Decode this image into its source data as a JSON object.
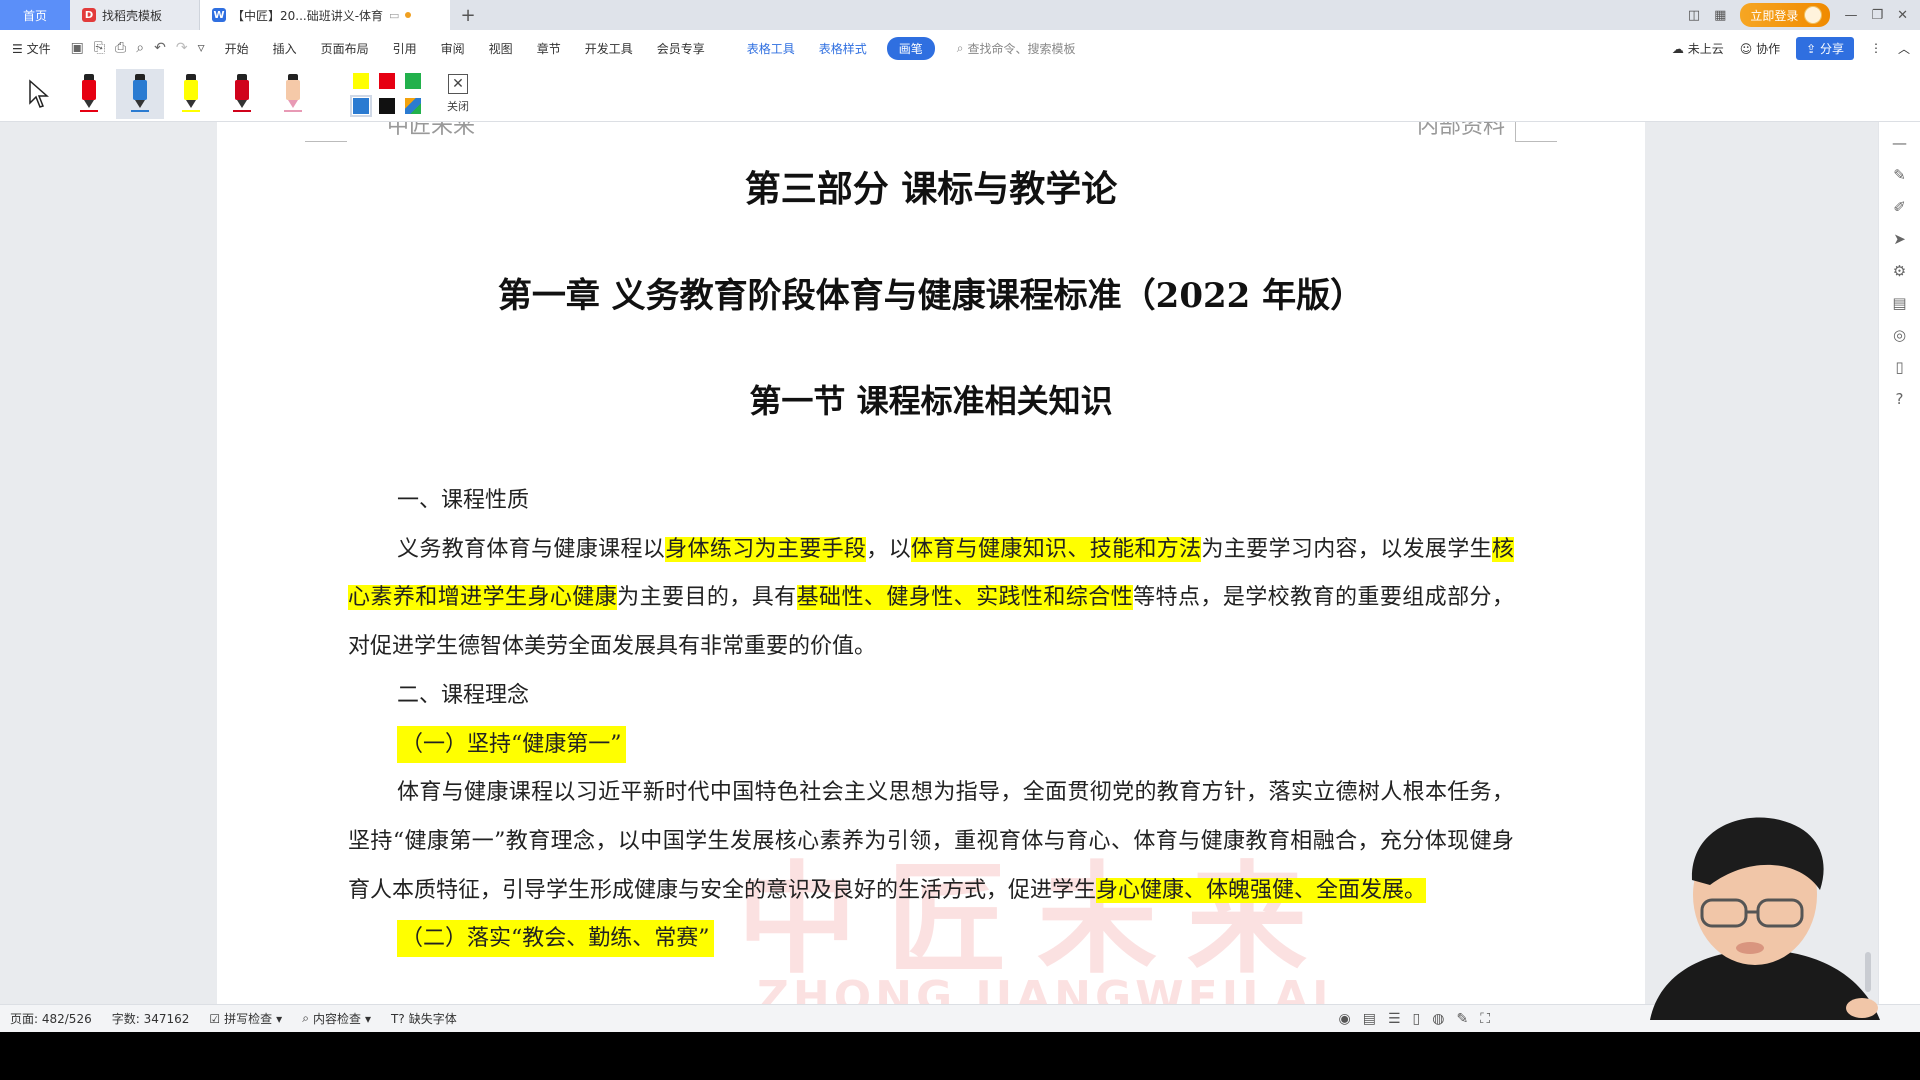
{
  "tabs": {
    "home": "首页",
    "template": "找稻壳模板",
    "doc": "【中匠】20...础班讲义-体育",
    "add": "+"
  },
  "titlebar": {
    "login": "立即登录"
  },
  "menu": {
    "file": "文件",
    "items": [
      "开始",
      "插入",
      "页面布局",
      "引用",
      "审阅",
      "视图",
      "章节",
      "开发工具",
      "会员专享"
    ],
    "ctx_table_tools": "表格工具",
    "ctx_table_style": "表格样式",
    "pen_tab": "画笔",
    "search": "查找命令、搜索模板",
    "cloud": "未上云",
    "collab": "协作",
    "share": "分享"
  },
  "pentools": {
    "close": "关闭",
    "swatch_colors": [
      "#ffff00",
      "#e60012",
      "#22b14c",
      "#2b7bd1",
      "#111111",
      "#f2a20d"
    ]
  },
  "document": {
    "header_left": "中匠未来",
    "header_right": "内部资料",
    "part_title": "第三部分  课标与教学论",
    "chapter_title": "第一章  义务教育阶段体育与健康课程标准（2022 年版）",
    "section_title": "第一节  课程标准相关知识",
    "heading1": "一、课程性质",
    "p1": {
      "t1": "义务教育体育与健康课程以",
      "h1": "身体练习为主要手段",
      "t2": "，以",
      "h2": "体育与健康知识、技能和方法",
      "t3": "为主要学习内容，以发展学生",
      "h3": "核心素养和增进学生身心健康",
      "t4": "为主要目的，具有",
      "h4": "基础性、健身性、实践性和综合性",
      "t5": "等特点，是学校教育的重要组成部分，对促进学生德智体美劳全面发展具有非常重要的价值。"
    },
    "heading2": "二、课程理念",
    "sub1": "（一）坚持“健康第一”",
    "p2": {
      "t1": "体育与健康课程以习近平新时代中国特色社会主义思想为指导，全面贯彻党的教育方针，落实立德树人根本任务，坚持“健康第一”教育理念，以中国学生发展核心素养为引领，重视育体与育心、体育与健康教育相融合，充分体现健身育人本质特征，引导学生形成健康与安全的意识及良好的生活方式，促进学生",
      "h1": "身心健康、体魄强健、全面发展。"
    },
    "sub2": "（二）落实“教会、勤练、常赛”",
    "watermark_cn": "中匠未来",
    "watermark_en": "ZHONG JIANGWEILAI"
  },
  "status": {
    "page": "页面: 482/526",
    "words": "字数: 347162",
    "spell": "拼写检查",
    "content": "内容检查",
    "font": "缺失字体"
  }
}
